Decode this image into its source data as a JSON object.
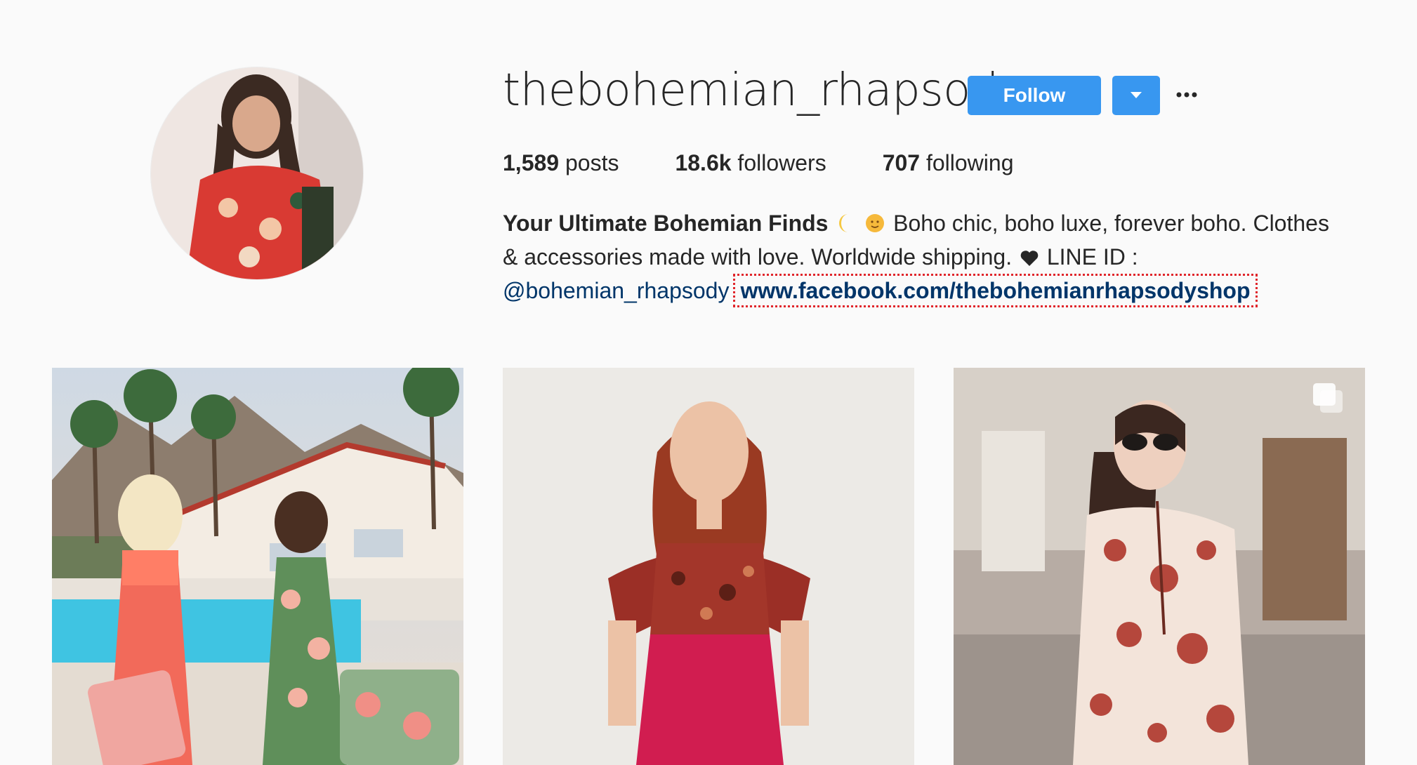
{
  "profile": {
    "username": "thebohemian_rhapsody",
    "follow_label": "Follow",
    "dropdown_icon": "caret-down-icon",
    "more_icon": "more-options-icon",
    "avatar_icon": "profile-avatar",
    "stats": {
      "posts_count": "1,589",
      "posts_label": "posts",
      "followers_count": "18.6k",
      "followers_label": "followers",
      "following_count": "707",
      "following_label": "following"
    },
    "bio": {
      "name": "Your Ultimate Bohemian Finds",
      "line1_rest": "Boho chic, boho luxe, forever boho. Clothes",
      "line2": "& accessories made with love. Worldwide shipping.",
      "line2_end": "LINE ID :",
      "mention": "@bohemian_rhapsody",
      "website": "www.facebook.com/thebohemianrhapsodyshop"
    }
  },
  "colors": {
    "accent": "#3897f0",
    "link": "#003569",
    "highlight": "#e0262b",
    "background": "#fafafa"
  },
  "posts": [
    {
      "name": "post-pool-suitcases",
      "multi": false
    },
    {
      "name": "post-red-ruffle-top",
      "multi": false
    },
    {
      "name": "post-floral-dress",
      "multi": true
    }
  ]
}
